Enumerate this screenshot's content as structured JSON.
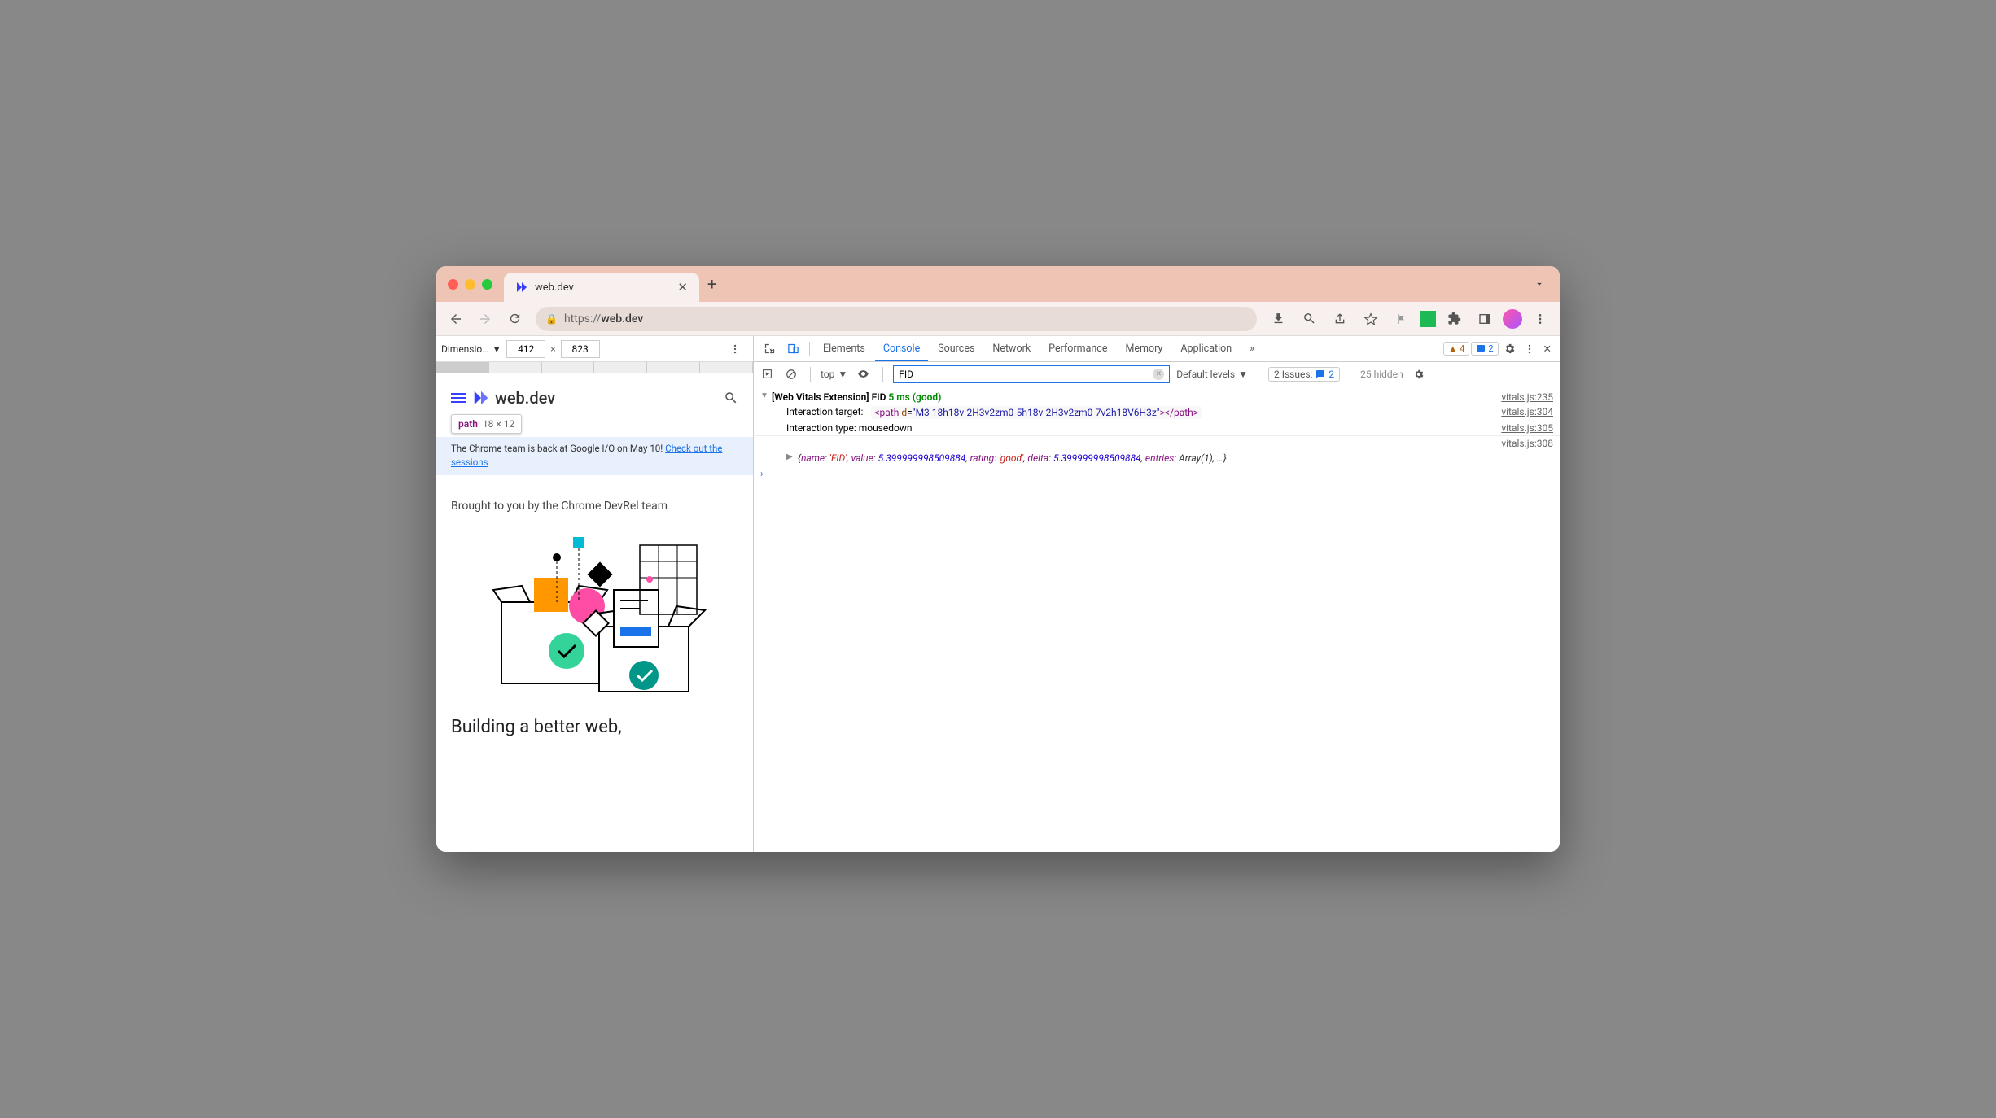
{
  "titlebar": {
    "tab_title": "web.dev"
  },
  "toolbar": {
    "url_prefix": "https://",
    "url_host": "web.dev"
  },
  "dims": {
    "label": "Dimensio…",
    "width": "412",
    "height": "823"
  },
  "tooltip": {
    "tag": "path",
    "size": "18 × 12"
  },
  "page": {
    "logo_text": "web.dev",
    "banner_text": "The Chrome team is back at Google I/O on May 10! ",
    "banner_link": "Check out the sessions",
    "devrel": "Brought to you by the Chrome DevRel team",
    "heading": "Building a better web,"
  },
  "devtools": {
    "tabs": [
      "Elements",
      "Console",
      "Sources",
      "Network",
      "Performance",
      "Memory",
      "Application"
    ],
    "active_tab": "Console",
    "warn_count": "4",
    "info_count": "2",
    "console": {
      "context": "top",
      "filter_value": "FID",
      "levels": "Default levels",
      "issues_label": "2 Issues:",
      "issues_count": "2",
      "hidden": "25 hidden"
    },
    "logs": {
      "l1_a": "[Web Vitals Extension] FID ",
      "l1_b": "5 ms (good)",
      "l1_src": "vitals.js:235",
      "l2_label": "Interaction target:",
      "l2_code_d": "\"M3 18h18v-2H3v2zm0-5h18v-2H3v2zm0-7v2h18V6H3z\"",
      "l2_src": "vitals.js:304",
      "l3": "Interaction type: mousedown",
      "l3_src": "vitals.js:305",
      "l4_src": "vitals.js:308",
      "obj_name": "'FID'",
      "obj_value": "5.399999998509884",
      "obj_rating": "'good'",
      "obj_delta": "5.399999998509884",
      "obj_entries": "Array(1)"
    }
  }
}
